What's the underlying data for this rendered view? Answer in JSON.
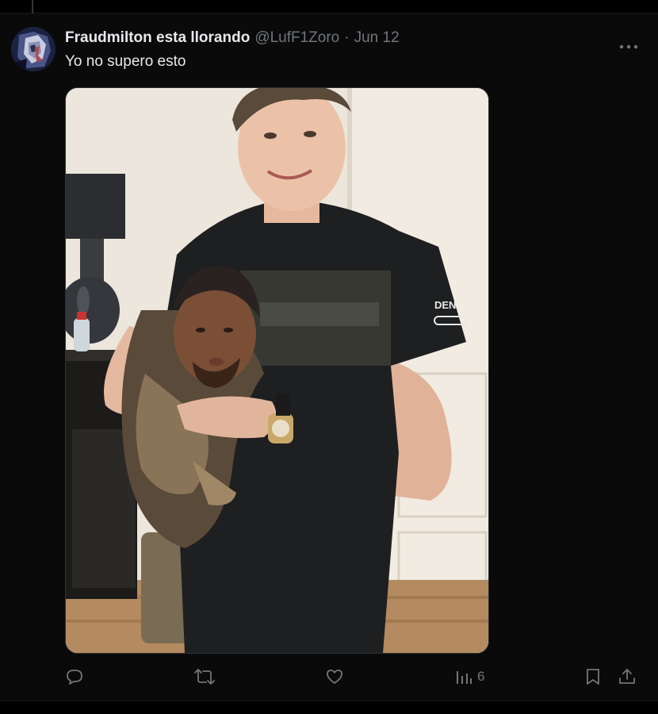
{
  "tweet": {
    "author": {
      "display_name": "Fraudmilton esta llorando",
      "handle": "@LufF1Zoro",
      "avatar_icon": "avatar-image"
    },
    "separator": "·",
    "date": "Jun 12",
    "text": "Yo no supero esto",
    "more_icon": "more-horizontal-icon",
    "media": {
      "type": "photo",
      "shirt_text": "DEN"
    },
    "actions": {
      "reply_icon": "reply-icon",
      "retweet_icon": "retweet-icon",
      "like_icon": "heart-icon",
      "views_icon": "views-bar-icon",
      "views_count": "6",
      "bookmark_icon": "bookmark-icon",
      "share_icon": "share-icon"
    }
  },
  "colors": {
    "background": "#000000",
    "text_primary": "#e7e9ea",
    "text_secondary": "#71767b"
  }
}
